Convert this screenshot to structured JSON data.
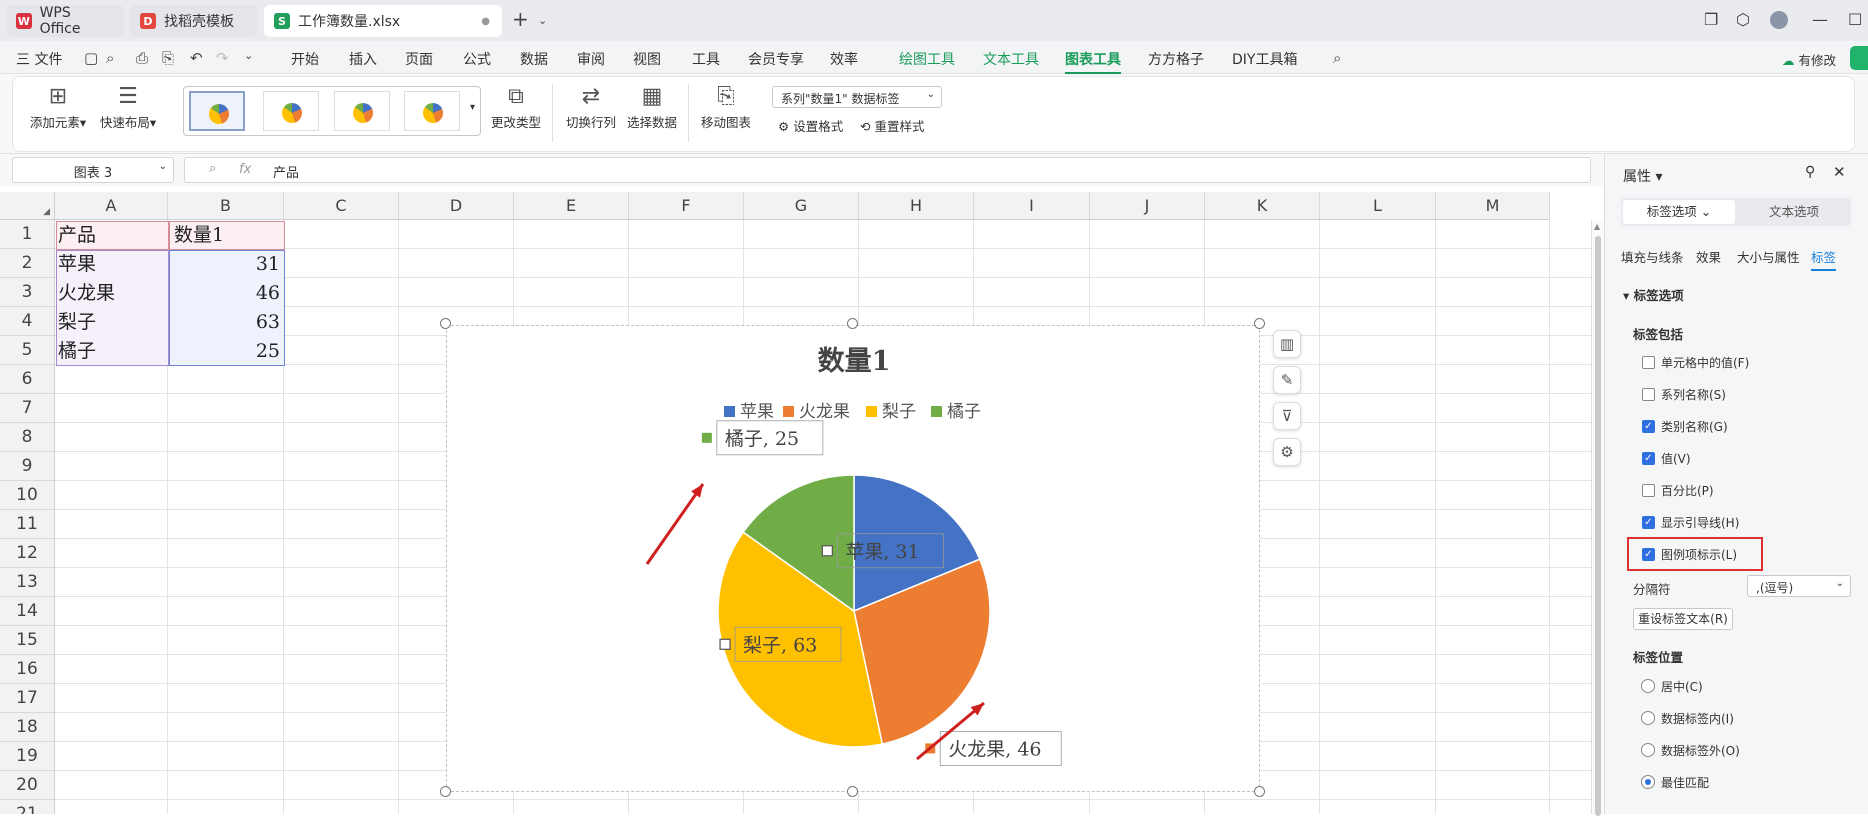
{
  "tabs": [
    {
      "label": "WPS Office"
    },
    {
      "label": "找稻壳模板"
    },
    {
      "label": "工作簿数量.xlsx"
    }
  ],
  "menu": {
    "file": "三 文件",
    "items": [
      "开始",
      "插入",
      "页面",
      "公式",
      "数据",
      "审阅",
      "视图",
      "工具",
      "会员专享",
      "效率",
      "绘图工具",
      "文本工具",
      "图表工具",
      "方方格子",
      "DIY工具箱"
    ],
    "share": "有修改"
  },
  "ribbon": {
    "add_element": "添加元素",
    "quick_layout": "快速布局",
    "change_type": "更改类型",
    "switch_rowcol": "切换行列",
    "select_data": "选择数据",
    "move_chart": "移动图表",
    "series_select": "系列\"数量1\" 数据标签",
    "set_format": "设置格式",
    "reset_style": "重置样式"
  },
  "formula": {
    "namebox": "图表 3",
    "fx": "fx",
    "content": "产品"
  },
  "columns": [
    "A",
    "B",
    "C",
    "D",
    "E",
    "F",
    "G",
    "H",
    "I",
    "J",
    "K",
    "L",
    "M"
  ],
  "rows": [
    "1",
    "2",
    "3",
    "4",
    "5",
    "6",
    "7",
    "8",
    "9",
    "10",
    "11",
    "12",
    "13",
    "14",
    "15",
    "16",
    "17",
    "18",
    "19",
    "20",
    "21"
  ],
  "cells": {
    "a1": "产品",
    "b1": "数量1",
    "a2": "苹果",
    "b2": "31",
    "a3": "火龙果",
    "b3": "46",
    "a4": "梨子",
    "b4": "63",
    "a5": "橘子",
    "b5": "25"
  },
  "panel": {
    "title": "属性",
    "tab_label_opts": "标签选项",
    "tab_text_opts": "文本选项",
    "sub_fill": "填充与线条",
    "sub_effect": "效果",
    "sub_size": "大小与属性",
    "sub_label": "标签",
    "section": "标签选项",
    "includes": "标签包括",
    "opts": [
      {
        "label": "单元格中的值(F)",
        "checked": false
      },
      {
        "label": "系列名称(S)",
        "checked": false
      },
      {
        "label": "类别名称(G)",
        "checked": true
      },
      {
        "label": "值(V)",
        "checked": true
      },
      {
        "label": "百分比(P)",
        "checked": false
      },
      {
        "label": "显示引导线(H)",
        "checked": true
      },
      {
        "label": "图例项标示(L)",
        "checked": true
      }
    ],
    "separator_label": "分隔符",
    "separator_value": ",(逗号)",
    "reset_text": "重设标签文本(R)",
    "position_label": "标签位置",
    "positions": [
      {
        "label": "居中(C)",
        "selected": false
      },
      {
        "label": "数据标签内(I)",
        "selected": false
      },
      {
        "label": "数据标签外(O)",
        "selected": false
      },
      {
        "label": "最佳匹配",
        "selected": true
      }
    ]
  },
  "chart_data": {
    "type": "pie",
    "title": "数量1",
    "categories": [
      "苹果",
      "火龙果",
      "梨子",
      "橘子"
    ],
    "values": [
      31,
      46,
      63,
      25
    ],
    "colors": [
      "#4472c4",
      "#ed7d31",
      "#ffc000",
      "#70ad47"
    ],
    "legend_position": "top",
    "data_labels": [
      "苹果, 31",
      "火龙果, 46",
      "梨子, 63",
      "橘子, 25"
    ]
  }
}
